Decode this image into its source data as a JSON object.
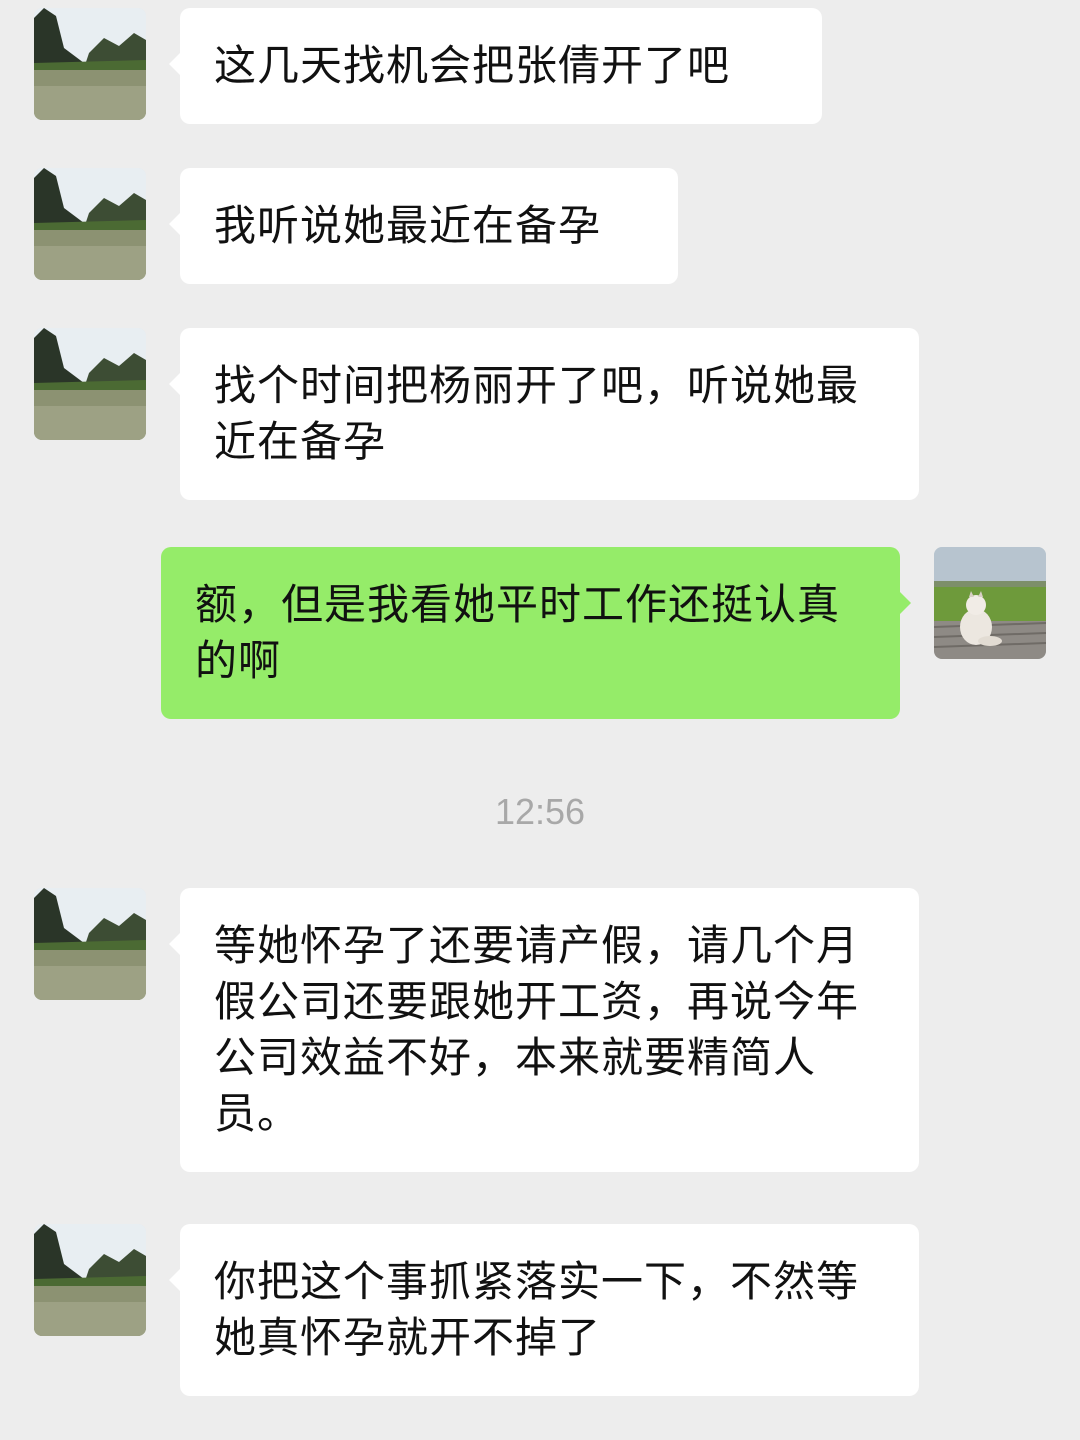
{
  "conversation": {
    "messages": [
      {
        "sender": "other",
        "text": "这几天找机会把张倩开了吧"
      },
      {
        "sender": "other",
        "text": "我听说她最近在备孕"
      },
      {
        "sender": "other",
        "text": "找个时间把杨丽开了吧，听说她最近在备孕"
      },
      {
        "sender": "me",
        "text": "额，但是我看她平时工作还挺认真的啊"
      },
      {
        "sender": "other",
        "text": "等她怀孕了还要请产假，请几个月假公司还要跟她开工资，再说今年公司效益不好，本来就要精简人员。"
      },
      {
        "sender": "other",
        "text": "你把这个事抓紧落实一下，不然等她真怀孕就开不掉了"
      }
    ],
    "timestamp": "12:56"
  },
  "avatars": {
    "other": "landscape-lake-avatar",
    "me": "cat-on-deck-avatar"
  },
  "colors": {
    "background": "#ededed",
    "incoming_bubble": "#ffffff",
    "outgoing_bubble": "#95ec69",
    "timestamp_text": "#a8a8a8"
  }
}
